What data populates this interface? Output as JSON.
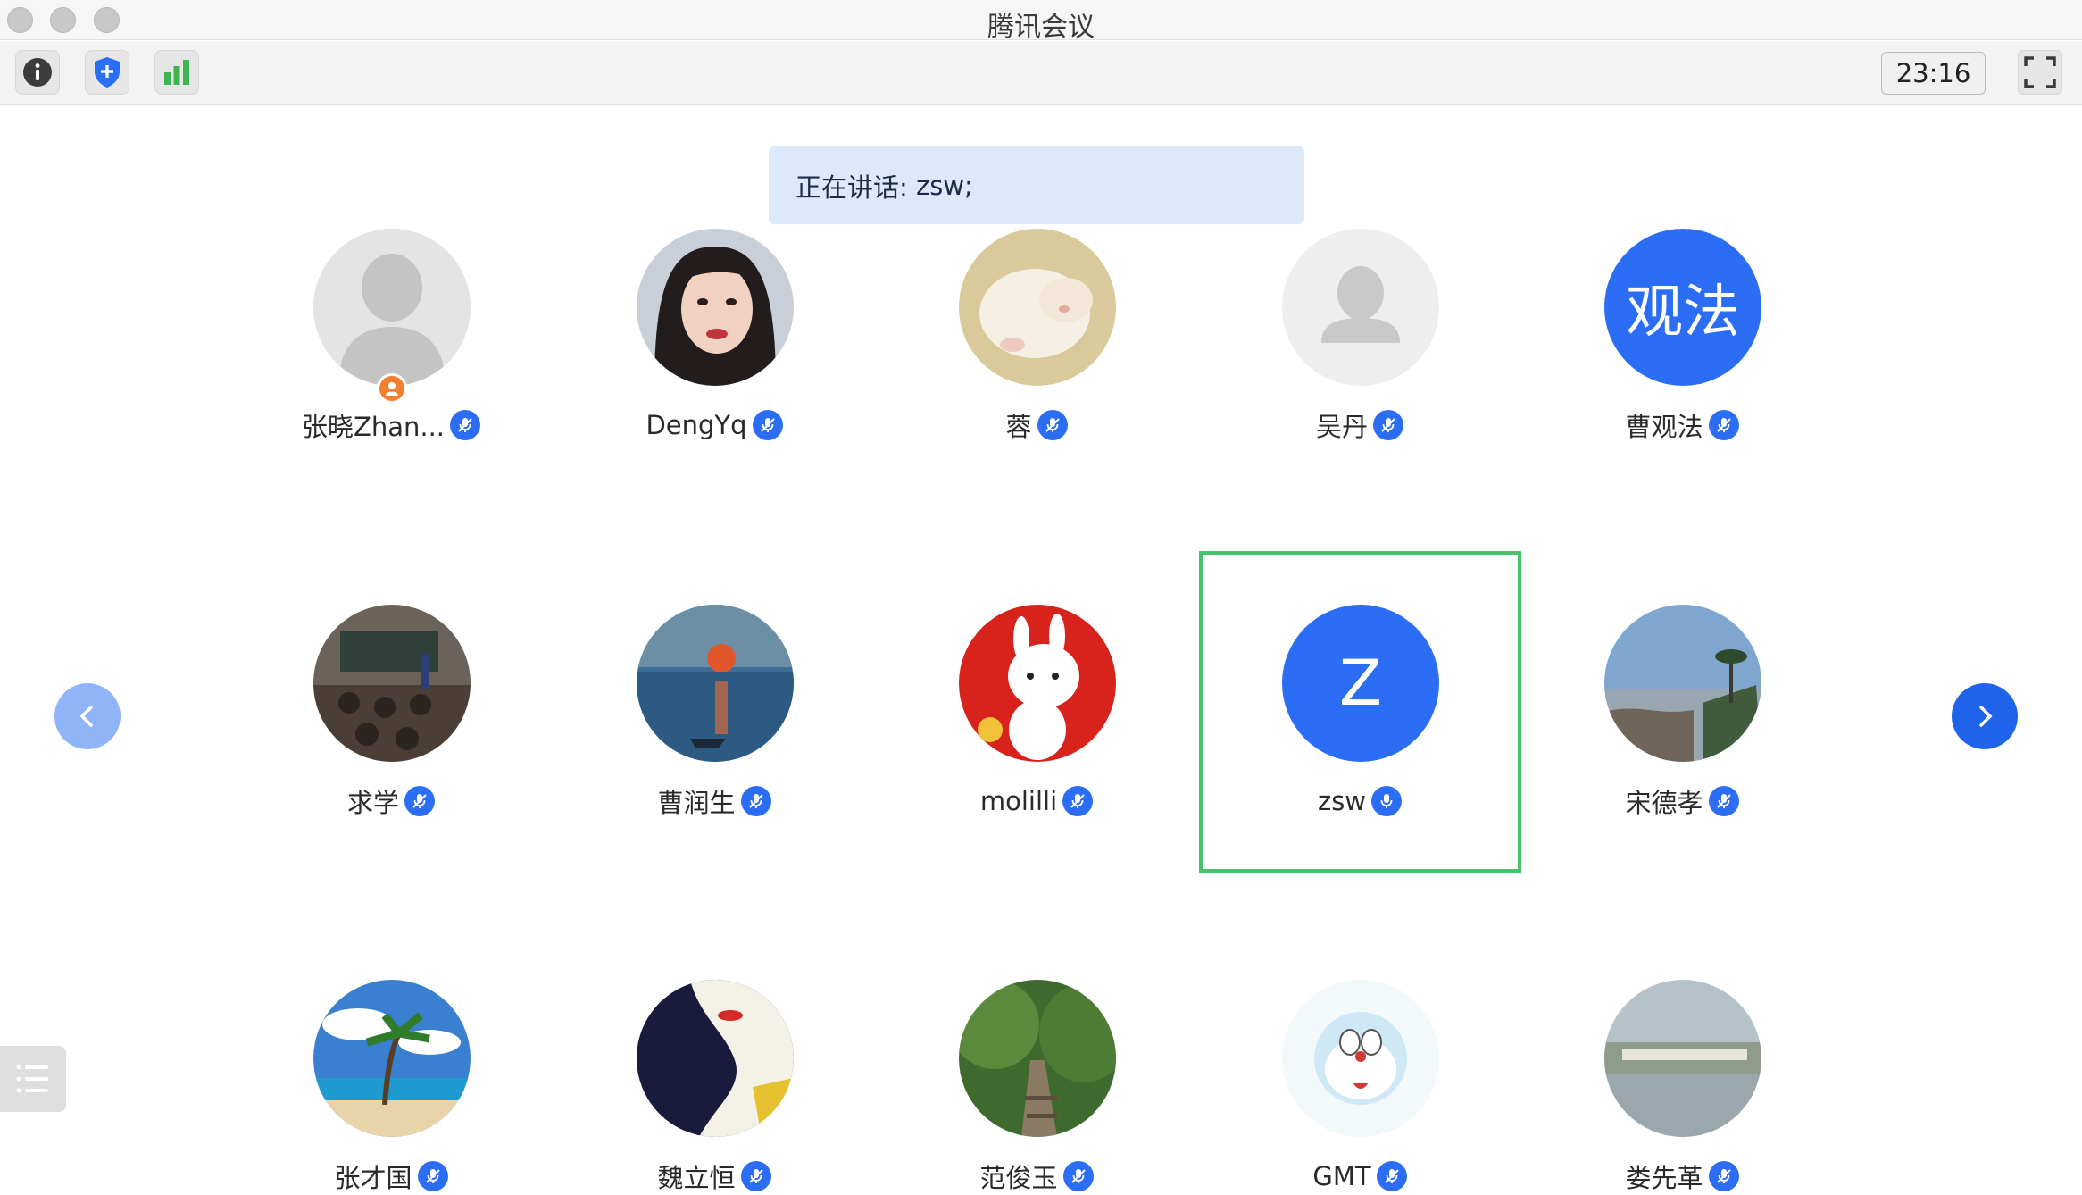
{
  "window": {
    "title": "腾讯会议"
  },
  "toolbar": {
    "clock": "23:16"
  },
  "speaking": {
    "label": "正在讲话:",
    "speakers": "zsw;"
  },
  "participants": [
    {
      "name": "张晓Zhan...",
      "avatar": "default-silhouette",
      "host": true,
      "mic": "muted"
    },
    {
      "name": "DengYq",
      "avatar": "photo-woman",
      "mic": "muted"
    },
    {
      "name": "蓉",
      "avatar": "photo-white-kitten",
      "mic": "muted"
    },
    {
      "name": "吴丹",
      "avatar": "default-person",
      "mic": "muted"
    },
    {
      "name": "曹观法",
      "avatar": "text",
      "avatar_text": "观法",
      "mic": "muted"
    },
    {
      "name": "求学",
      "avatar": "photo-classroom",
      "mic": "muted"
    },
    {
      "name": "曹润生",
      "avatar": "photo-impressionist-sunrise",
      "mic": "muted"
    },
    {
      "name": "molilli",
      "avatar": "photo-cartoon-rabbit",
      "mic": "muted"
    },
    {
      "name": "zsw",
      "avatar": "text",
      "avatar_text": "Z",
      "mic": "active",
      "speaking": true
    },
    {
      "name": "宋德孝",
      "avatar": "photo-coast",
      "mic": "muted"
    },
    {
      "name": "张才国",
      "avatar": "photo-palm-beach",
      "mic": "muted"
    },
    {
      "name": "魏立恒",
      "avatar": "photo-art-portrait",
      "mic": "muted"
    },
    {
      "name": "范俊玉",
      "avatar": "photo-forest-steps",
      "mic": "muted"
    },
    {
      "name": "GMT",
      "avatar": "photo-doraemon",
      "mic": "muted"
    },
    {
      "name": "娄先革",
      "avatar": "photo-lake-bridge",
      "mic": "muted"
    }
  ],
  "icons": {
    "info": "info-icon",
    "security": "shield-icon",
    "network": "signal-bars-icon",
    "fullscreen": "fullscreen-icon",
    "prev": "chevron-left-icon",
    "next": "chevron-right-icon",
    "list": "list-icon"
  },
  "colors": {
    "accent": "#2b6ef5",
    "speaking_border": "#47c36a",
    "banner_bg": "#dce9fb",
    "host_badge": "#f0802f"
  }
}
